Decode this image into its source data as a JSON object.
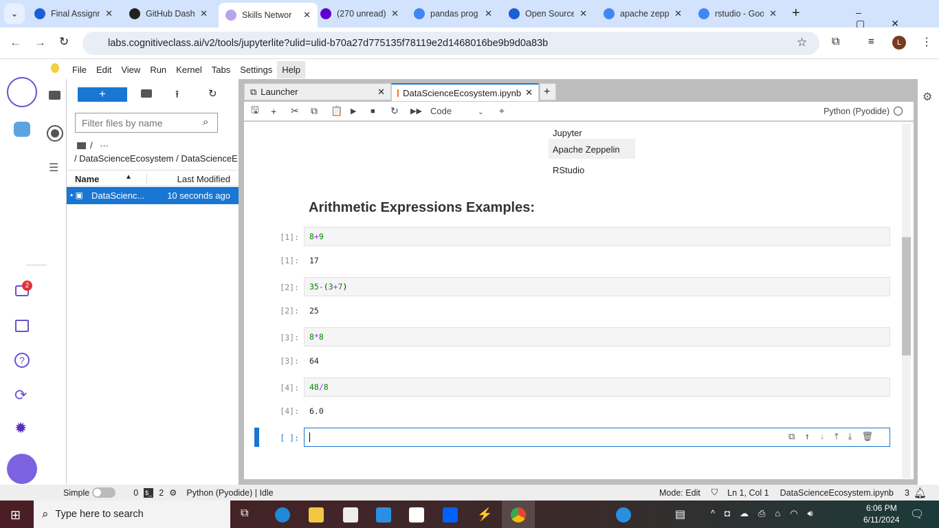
{
  "browser": {
    "tabs": [
      {
        "label": "Final Assignm",
        "icon": "coursera-icon",
        "color": "#1a5fd6"
      },
      {
        "label": "GitHub Dash",
        "icon": "github-icon",
        "color": "#222"
      },
      {
        "label": "Skills Networ",
        "icon": "skills-network-icon",
        "color": "#b9a4e8",
        "active": true
      },
      {
        "label": "(270 unread)",
        "icon": "mail-icon",
        "color": "#6001d2"
      },
      {
        "label": "pandas prog",
        "icon": "google-icon",
        "color": "#4285f4"
      },
      {
        "label": "Open Source",
        "icon": "coursera-icon",
        "color": "#1a5fd6"
      },
      {
        "label": "apache zepp",
        "icon": "google-icon",
        "color": "#4285f4"
      },
      {
        "label": "rstudio - Goo",
        "icon": "google-icon",
        "color": "#4285f4"
      }
    ],
    "url": "labs.cognitiveclass.ai/v2/tools/jupyterlite?ulid=ulid-b70a27d775135f78119e2d1468016be9b9d0a83b",
    "profile": "L"
  },
  "menu": [
    "File",
    "Edit",
    "View",
    "Run",
    "Kernel",
    "Tabs",
    "Settings",
    "Help"
  ],
  "leftbar": {
    "badge": "2"
  },
  "filebrowser": {
    "new_label": "+",
    "filter_placeholder": "Filter files by name",
    "path_root": "/",
    "path_more": "···",
    "breadcrumb": "/ DataScienceEcosystem / DataScienceE",
    "col_name": "Name",
    "col_modified": "Last Modified",
    "files": [
      {
        "name": "DataScienc...",
        "modified": "10 seconds ago"
      }
    ]
  },
  "notebook": {
    "tabs": [
      "Launcher",
      "DataScienceEcosystem.ipynb"
    ],
    "cell_type": "Code",
    "kernel": "Python (Pyodide)",
    "table_rows": [
      "Jupyter",
      "Apache Zeppelin",
      "RStudio"
    ],
    "heading": "Arithmetic Expressions Examples:",
    "cells": [
      {
        "in": "[1]:",
        "code": [
          [
            "8",
            "num"
          ],
          [
            "+",
            "op"
          ],
          [
            "9",
            "num"
          ]
        ],
        "out_prompt": "[1]:",
        "out": "17"
      },
      {
        "in": "[2]:",
        "code": [
          [
            "35",
            "num"
          ],
          [
            "-",
            "op"
          ],
          [
            "(",
            ""
          ],
          [
            "3",
            "num"
          ],
          [
            "+",
            "op"
          ],
          [
            "7",
            "num"
          ],
          [
            ")",
            ""
          ]
        ],
        "out_prompt": "[2]:",
        "out": "25"
      },
      {
        "in": "[3]:",
        "code": [
          [
            "8",
            "num"
          ],
          [
            "*",
            "op"
          ],
          [
            "8",
            "num"
          ]
        ],
        "out_prompt": "[3]:",
        "out": "64"
      },
      {
        "in": "[4]:",
        "code": [
          [
            "48",
            "num"
          ],
          [
            "/",
            "op"
          ],
          [
            "8",
            "num"
          ]
        ],
        "out_prompt": "[4]:",
        "out": "6.0"
      }
    ],
    "active_prompt": "[ ]:"
  },
  "status": {
    "mode_label": "Simple",
    "terminals": "0",
    "kernels": "2",
    "kernel_status": "Python (Pyodide) | Idle",
    "mode": "Mode: Edit",
    "position": "Ln 1, Col 1",
    "file": "DataScienceEcosystem.ipynb",
    "notifications": "3"
  },
  "taskbar": {
    "search_placeholder": "Type here to search",
    "time": "6:06 PM",
    "date": "6/11/2024"
  }
}
